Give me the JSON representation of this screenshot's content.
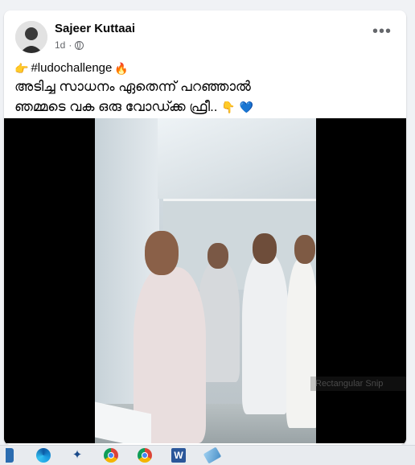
{
  "post": {
    "author": "Sajeer Kuttaai",
    "time": "1d",
    "privacy_icon": "globe-icon",
    "more_label": "•••",
    "caption": {
      "hashtag": "#ludochallenge",
      "line1": "അടിച്ച സാധനം ഏതെന്ന് പറഞ്ഞാൽ",
      "line2": "ഞമ്മടെ വക ഒരു വോഡ്ക്ക ഫ്രീ.."
    },
    "emoji": {
      "pointing": "👉",
      "fire": "🔥",
      "pointing_down": "👇",
      "heart": "💙"
    }
  },
  "overlay": {
    "snip_label": "Rectangular Snip"
  },
  "taskbar": {
    "items": [
      "edge-icon",
      "bird-app-icon",
      "chrome-icon",
      "chrome-icon",
      "word-icon",
      "eraser-icon"
    ]
  }
}
